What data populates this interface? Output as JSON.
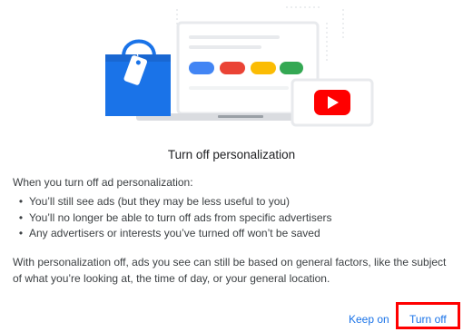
{
  "dialog": {
    "title": "Turn off personalization",
    "intro": "When you turn off ad personalization:",
    "bullets": [
      "You’ll still see ads (but they may be less useful to you)",
      "You’ll no longer be able to turn off ads from specific advertisers",
      "Any advertisers or interests you’ve turned off won’t be saved"
    ],
    "paragraph": "With personalization off, ads you see can still be based on general factors, like the subject of what you’re looking at, the time of day, or your general location.",
    "keep_on_label": "Keep on",
    "turn_off_label": "Turn off"
  },
  "illustration": {
    "icons": [
      "shopping-bag-icon",
      "laptop-icon",
      "youtube-icon"
    ],
    "colors": {
      "bag_blue": "#1a73e8",
      "pill_blue": "#4285f4",
      "pill_red": "#ea4335",
      "pill_yellow": "#fbbc04",
      "pill_green": "#34a853",
      "youtube_red": "#ff0000",
      "highlight_red": "#ff0000",
      "link_blue": "#1a73e8"
    }
  }
}
